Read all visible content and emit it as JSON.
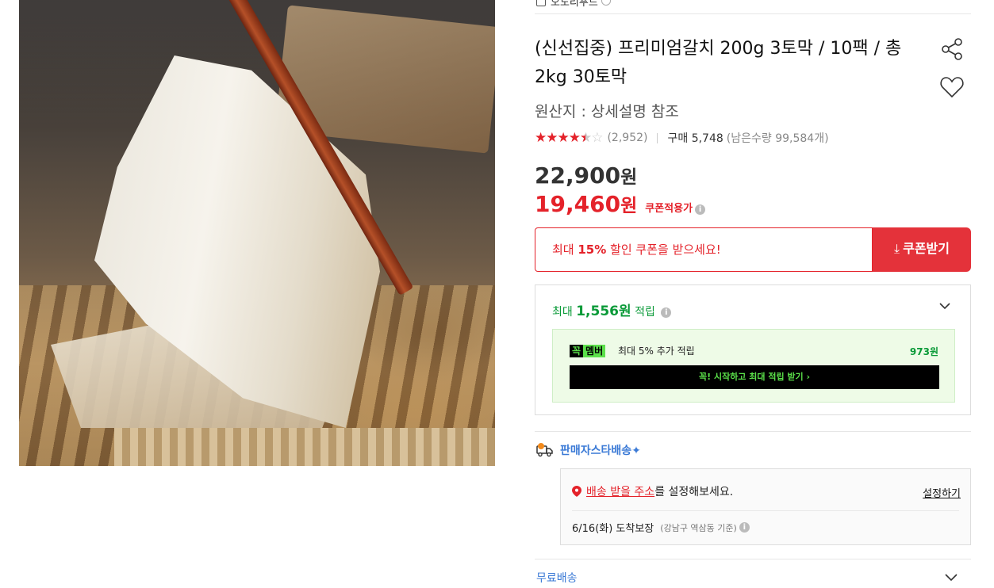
{
  "brand": {
    "label": "오도리푸드"
  },
  "product": {
    "title": "(신선집중) 프리미엄갈치 200g 3토막 / 10팩 / 총2kg 30토막",
    "origin": "원산지 : 상세설명 참조",
    "rating_stars": 4.5,
    "review_count": "(2,952)",
    "purchase": "구매 5,748",
    "remaining": "(남은수량 99,584개)"
  },
  "price": {
    "original": "22,900",
    "sale": "19,460",
    "currency": "원",
    "coupon_tag": "쿠폰적용가"
  },
  "coupon": {
    "prefix": "최대 ",
    "percent": "15%",
    "suffix": " 할인 쿠폰을 받으세요!",
    "button": "쿠폰받기"
  },
  "reward": {
    "prefix": "최대 ",
    "amount": "1,556원",
    "suffix": " 적립",
    "member_k": "꼭",
    "member_m": "멤버",
    "member_desc": "최대 5% 추가 적립",
    "member_amount": "973원",
    "member_button": "꼭! 시작하고 최대 적립 받기 ›"
  },
  "shipping": {
    "title": "판매자스타배송✦",
    "address_link": "배송 받을 주소",
    "address_suffix": "를 설정해보세요.",
    "set_link": "설정하기",
    "arrival": "6/16(화) 도착보장",
    "arrival_sub": "(강남구 역삼동 기준)",
    "free": "무료배송"
  },
  "colors": {
    "accent_red": "#e4222a",
    "reward_green": "#0a9a38",
    "link_blue": "#3b7ad6"
  }
}
